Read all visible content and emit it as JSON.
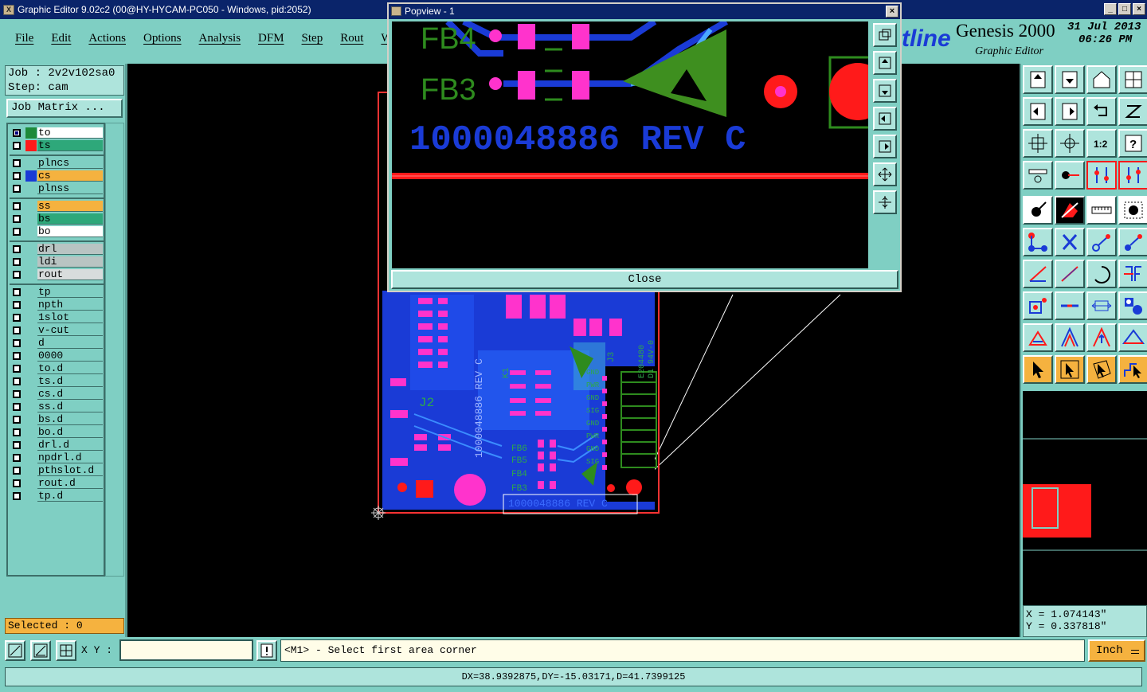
{
  "window": {
    "title": "Graphic Editor 9.02c2 (00@HY-HYCAM-PC050 - Windows, pid:2052)",
    "icon": "x-app-icon"
  },
  "menu": [
    "File",
    "Edit",
    "Actions",
    "Options",
    "Analysis",
    "DFM",
    "Step",
    "Rout",
    "Windo"
  ],
  "branding": {
    "logo_fragment": "tline",
    "product": "Genesis 2000",
    "subtitle": "Graphic Editor",
    "date": "31 Jul 2013",
    "time": "06:26 PM"
  },
  "job": {
    "job_line": "Job : 2v2v102sa0",
    "step_line": "Step: cam",
    "job_matrix_label": "Job Matrix ..."
  },
  "layers": [
    {
      "name": "to",
      "color": "#1e8a3a",
      "highlight": "#ffffff",
      "checked": true
    },
    {
      "name": "ts",
      "color": "#ff1a1a",
      "highlight": "#2ea87a",
      "checked": false
    },
    {
      "name": "plncs",
      "color": "",
      "highlight": "",
      "checked": false
    },
    {
      "name": "cs",
      "color": "#1a3bd6",
      "highlight": "#f5b23f",
      "checked": false
    },
    {
      "name": "plnss",
      "color": "",
      "highlight": "",
      "checked": false
    },
    {
      "name": "ss",
      "color": "",
      "highlight": "#f5b23f",
      "checked": false
    },
    {
      "name": "bs",
      "color": "",
      "highlight": "#2ea87a",
      "checked": false
    },
    {
      "name": "bo",
      "color": "",
      "highlight": "#ffffff",
      "checked": false
    },
    {
      "name": "drl",
      "color": "",
      "highlight": "#b8c4c2",
      "checked": false
    },
    {
      "name": "ldi",
      "color": "",
      "highlight": "#b8c4c2",
      "checked": false
    },
    {
      "name": "rout",
      "color": "",
      "highlight": "#d8dcdc",
      "checked": false
    },
    {
      "name": "tp",
      "color": "",
      "highlight": "",
      "checked": false
    },
    {
      "name": "npth",
      "color": "",
      "highlight": "",
      "checked": false
    },
    {
      "name": "1slot",
      "color": "",
      "highlight": "",
      "checked": false
    },
    {
      "name": "v-cut",
      "color": "",
      "highlight": "",
      "checked": false
    },
    {
      "name": "d",
      "color": "",
      "highlight": "",
      "checked": false
    },
    {
      "name": "0000",
      "color": "",
      "highlight": "",
      "checked": false
    },
    {
      "name": "to.d",
      "color": "",
      "highlight": "",
      "checked": false
    },
    {
      "name": "ts.d",
      "color": "",
      "highlight": "",
      "checked": false
    },
    {
      "name": "cs.d",
      "color": "",
      "highlight": "",
      "checked": false
    },
    {
      "name": "ss.d",
      "color": "",
      "highlight": "",
      "checked": false
    },
    {
      "name": "bs.d",
      "color": "",
      "highlight": "",
      "checked": false
    },
    {
      "name": "bo.d",
      "color": "",
      "highlight": "",
      "checked": false
    },
    {
      "name": "drl.d",
      "color": "",
      "highlight": "",
      "checked": false
    },
    {
      "name": "npdrl.d",
      "color": "",
      "highlight": "",
      "checked": false
    },
    {
      "name": "pthslot.d",
      "color": "",
      "highlight": "",
      "checked": false
    },
    {
      "name": "rout.d",
      "color": "",
      "highlight": "",
      "checked": false
    },
    {
      "name": "tp.d",
      "color": "",
      "highlight": "",
      "checked": false
    }
  ],
  "selected_label": "Selected : 0",
  "board": {
    "board_text": "1000048886 REV C",
    "labels": [
      "J2",
      "K1",
      "J3",
      "FB6",
      "FB5",
      "FB4",
      "FB3"
    ],
    "pin_labels": [
      "GND",
      "PWR",
      "GND",
      "SIG",
      "GND",
      "PWR",
      "GND",
      "SIG"
    ],
    "side_text": [
      "E204480",
      "D1 94V-0"
    ]
  },
  "popview": {
    "title": "Popview - 1",
    "close_label": "Close",
    "zoom_text": "1000048886 REV C",
    "fb_labels": [
      "FB4",
      "FB3"
    ]
  },
  "coords": {
    "x_line": "X = 1.074143\"",
    "y_line": "Y = 0.337818\""
  },
  "cmd": {
    "xy_label": "X Y :",
    "xy_value": "",
    "message": "<M1> - Select first area corner",
    "unit": "Inch"
  },
  "status": "DX=38.9392875,DY=-15.03171,D=41.7399125",
  "colors": {
    "panel": "#7fcfc3",
    "accent_orange": "#f5b23f",
    "copper_blue": "#1a3bd6",
    "pad_magenta": "#ff33cc",
    "silk_green": "#2e8b1e",
    "mask_red": "#ff1a1a"
  }
}
